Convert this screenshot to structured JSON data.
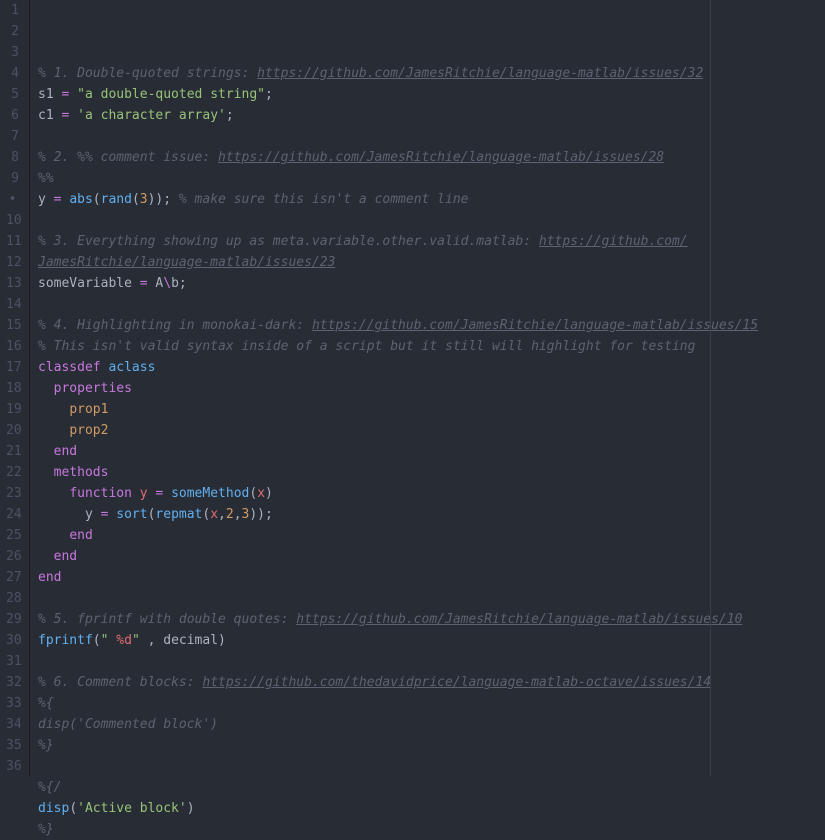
{
  "gutter": {
    "lines": [
      "1",
      "2",
      "3",
      "4",
      "5",
      "6",
      "7",
      "8",
      "9",
      "•",
      "10",
      "11",
      "12",
      "13",
      "14",
      "15",
      "16",
      "17",
      "18",
      "19",
      "20",
      "21",
      "22",
      "23",
      "24",
      "25",
      "26",
      "27",
      "28",
      "29",
      "30",
      "31",
      "32",
      "33",
      "34",
      "35",
      "36"
    ]
  },
  "code": {
    "lines": [
      [
        {
          "cls": "cm",
          "t": "% 1. Double-quoted strings: "
        },
        {
          "cls": "lnk",
          "t": "https://github.com/JamesRitchie/language-matlab/issues/32"
        }
      ],
      [
        {
          "cls": "pl",
          "t": "s1 "
        },
        {
          "cls": "kw",
          "t": "="
        },
        {
          "cls": "pl",
          "t": " "
        },
        {
          "cls": "str",
          "t": "\"a double-quoted string\""
        },
        {
          "cls": "pl",
          "t": ";"
        }
      ],
      [
        {
          "cls": "pl",
          "t": "c1 "
        },
        {
          "cls": "kw",
          "t": "="
        },
        {
          "cls": "pl",
          "t": " "
        },
        {
          "cls": "str",
          "t": "'a character array'"
        },
        {
          "cls": "pl",
          "t": ";"
        }
      ],
      [],
      [
        {
          "cls": "cm",
          "t": "% 2. %% comment issue: "
        },
        {
          "cls": "lnk",
          "t": "https://github.com/JamesRitchie/language-matlab/issues/28"
        }
      ],
      [
        {
          "cls": "cm",
          "t": "%%"
        }
      ],
      [
        {
          "cls": "pl",
          "t": "y "
        },
        {
          "cls": "kw",
          "t": "="
        },
        {
          "cls": "pl",
          "t": " "
        },
        {
          "cls": "fn",
          "t": "abs"
        },
        {
          "cls": "pl",
          "t": "("
        },
        {
          "cls": "fn",
          "t": "rand"
        },
        {
          "cls": "pl",
          "t": "("
        },
        {
          "cls": "num",
          "t": "3"
        },
        {
          "cls": "pl",
          "t": ")); "
        },
        {
          "cls": "cm",
          "t": "% make sure this isn't a comment line"
        }
      ],
      [],
      [
        {
          "cls": "cm",
          "t": "% 3. Everything showing up as meta.variable.other.valid.matlab: "
        },
        {
          "cls": "lnk",
          "t": "https://github.com/"
        }
      ],
      [
        {
          "cls": "lnk",
          "t": "JamesRitchie/language-matlab/issues/23"
        }
      ],
      [
        {
          "cls": "pl",
          "t": "someVariable "
        },
        {
          "cls": "kw",
          "t": "="
        },
        {
          "cls": "pl",
          "t": " A"
        },
        {
          "cls": "kw",
          "t": "\\"
        },
        {
          "cls": "pl",
          "t": "b;"
        }
      ],
      [],
      [
        {
          "cls": "cm",
          "t": "% 4. Highlighting in monokai-dark: "
        },
        {
          "cls": "lnk",
          "t": "https://github.com/JamesRitchie/language-matlab/issues/15"
        }
      ],
      [
        {
          "cls": "cm",
          "t": "% This isn't valid syntax inside of a script but it still will highlight for testing"
        }
      ],
      [
        {
          "cls": "kw",
          "t": "classdef"
        },
        {
          "cls": "pl",
          "t": " "
        },
        {
          "cls": "fn",
          "t": "aclass"
        }
      ],
      [
        {
          "cls": "pl",
          "t": "  "
        },
        {
          "cls": "kw",
          "t": "properties"
        }
      ],
      [
        {
          "cls": "pl",
          "t": "    "
        },
        {
          "cls": "pr",
          "t": "prop1"
        }
      ],
      [
        {
          "cls": "pl",
          "t": "    "
        },
        {
          "cls": "pr",
          "t": "prop2"
        }
      ],
      [
        {
          "cls": "pl",
          "t": "  "
        },
        {
          "cls": "kw",
          "t": "end"
        }
      ],
      [
        {
          "cls": "pl",
          "t": "  "
        },
        {
          "cls": "kw",
          "t": "methods"
        }
      ],
      [
        {
          "cls": "pl",
          "t": "    "
        },
        {
          "cls": "kw",
          "t": "function"
        },
        {
          "cls": "pl",
          "t": " "
        },
        {
          "cls": "id",
          "t": "y"
        },
        {
          "cls": "pl",
          "t": " "
        },
        {
          "cls": "kw",
          "t": "="
        },
        {
          "cls": "pl",
          "t": " "
        },
        {
          "cls": "fn",
          "t": "someMethod"
        },
        {
          "cls": "pl",
          "t": "("
        },
        {
          "cls": "id",
          "t": "x"
        },
        {
          "cls": "pl",
          "t": ")"
        }
      ],
      [
        {
          "cls": "pl",
          "t": "      y "
        },
        {
          "cls": "kw",
          "t": "="
        },
        {
          "cls": "pl",
          "t": " "
        },
        {
          "cls": "fn",
          "t": "sort"
        },
        {
          "cls": "pl",
          "t": "("
        },
        {
          "cls": "fn",
          "t": "repmat"
        },
        {
          "cls": "pl",
          "t": "("
        },
        {
          "cls": "id",
          "t": "x"
        },
        {
          "cls": "pl",
          "t": ","
        },
        {
          "cls": "num",
          "t": "2"
        },
        {
          "cls": "pl",
          "t": ","
        },
        {
          "cls": "num",
          "t": "3"
        },
        {
          "cls": "pl",
          "t": "));"
        }
      ],
      [
        {
          "cls": "pl",
          "t": "    "
        },
        {
          "cls": "kw",
          "t": "end"
        }
      ],
      [
        {
          "cls": "pl",
          "t": "  "
        },
        {
          "cls": "kw",
          "t": "end"
        }
      ],
      [
        {
          "cls": "kw",
          "t": "end"
        }
      ],
      [],
      [
        {
          "cls": "cm",
          "t": "% 5. fprintf with double quotes: "
        },
        {
          "cls": "lnk",
          "t": "https://github.com/JamesRitchie/language-matlab/issues/10"
        }
      ],
      [
        {
          "cls": "fn",
          "t": "fprintf"
        },
        {
          "cls": "pl",
          "t": "("
        },
        {
          "cls": "str",
          "t": "\" "
        },
        {
          "cls": "id",
          "t": "%d"
        },
        {
          "cls": "str",
          "t": "\""
        },
        {
          "cls": "pl",
          "t": " , decimal)"
        }
      ],
      [],
      [
        {
          "cls": "cm",
          "t": "% 6. Comment blocks: "
        },
        {
          "cls": "lnk",
          "t": "https://github.com/thedavidprice/language-matlab-octave/issues/14"
        }
      ],
      [
        {
          "cls": "cm",
          "t": "%{"
        }
      ],
      [
        {
          "cls": "cm",
          "t": "disp('Commented block')"
        }
      ],
      [
        {
          "cls": "cm",
          "t": "%}"
        }
      ],
      [],
      [
        {
          "cls": "cm",
          "t": "%{/"
        }
      ],
      [
        {
          "cls": "fn",
          "t": "disp"
        },
        {
          "cls": "pl",
          "t": "("
        },
        {
          "cls": "str",
          "t": "'Active block'"
        },
        {
          "cls": "pl",
          "t": ")"
        }
      ],
      [
        {
          "cls": "cm",
          "t": "%}"
        }
      ]
    ]
  }
}
